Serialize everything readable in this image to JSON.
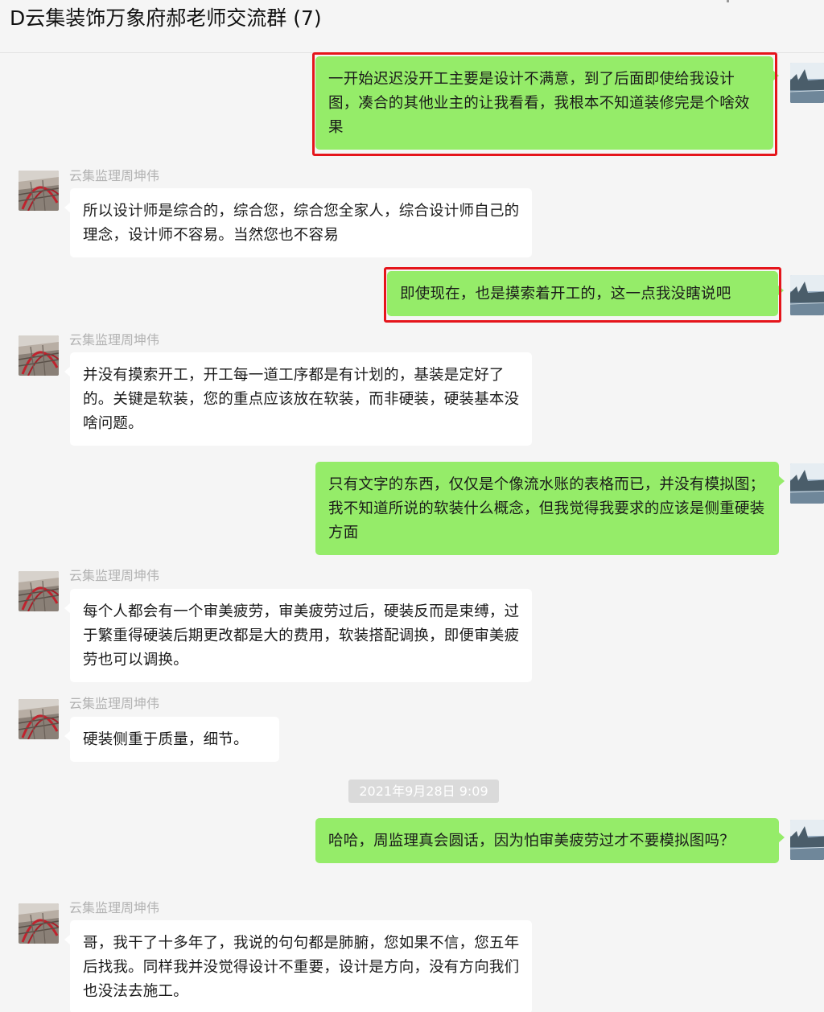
{
  "chat": {
    "title": "D云集装饰万象府郝老师交流群 (7)"
  },
  "colors": {
    "outgoing_bubble": "#95ec69",
    "incoming_bubble": "#ffffff",
    "highlight_box": "#e5151b",
    "background": "#f5f5f5"
  },
  "messages": [
    {
      "side": "out",
      "text": "一开始迟迟没开工主要是设计不满意，到了后面即使给我设计图，凑合的其他业主的让我看看，我根本不知道装修完是个啥效果",
      "highlighted": true
    },
    {
      "side": "in",
      "sender": "云集监理周坤伟",
      "text": "所以设计师是综合的，综合您，综合您全家人，综合设计师自己的理念，设计师不容易。当然您也不容易"
    },
    {
      "side": "out",
      "text": "即使现在，也是摸索着开工的，这一点我没瞎说吧",
      "highlighted": true
    },
    {
      "side": "in",
      "sender": "云集监理周坤伟",
      "text": "并没有摸索开工，开工每一道工序都是有计划的，基装是定好了的。关键是软装，您的重点应该放在软装，而非硬装，硬装基本没啥问题。"
    },
    {
      "side": "out",
      "text": "只有文字的东西，仅仅是个像流水账的表格而已，并没有模拟图；我不知道所说的软装什么概念，但我觉得我要求的应该是侧重硬装方面"
    },
    {
      "side": "in",
      "sender": "云集监理周坤伟",
      "text": "每个人都会有一个审美疲劳，审美疲劳过后，硬装反而是束缚，过于繁重得硬装后期更改都是大的费用，软装搭配调换，即便审美疲劳也可以调换。"
    },
    {
      "side": "in",
      "sender": "云集监理周坤伟",
      "text": "硬装侧重于质量，细节。"
    },
    {
      "side": "out",
      "text": "哈哈，周监理真会圆话，因为怕审美疲劳过才不要模拟图吗？"
    },
    {
      "side": "in",
      "sender": "云集监理周坤伟",
      "text": "哥，我干了十多年了，我说的句句都是肺腑，您如果不信，您五年后找我。同样我并没觉得设计不重要，设计是方向，没有方向我们也没法去施工。"
    }
  ],
  "timestamp": "2021年9月28日 9:09"
}
